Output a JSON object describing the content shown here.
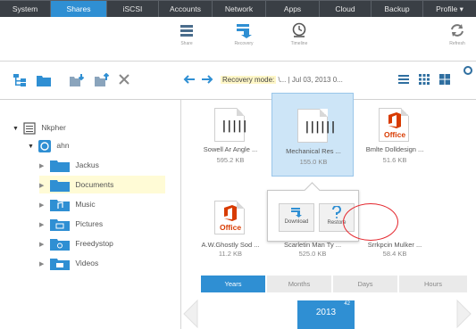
{
  "nav": {
    "tabs": [
      "System",
      "Shares",
      "iSCSI",
      "Accounts",
      "Network",
      "Apps",
      "Cloud",
      "Backup",
      "Profile ▾"
    ],
    "active_index": 1
  },
  "toolbar": {
    "share_label": "Share",
    "recovery_label": "Recovery",
    "timeline_label": "Timeline",
    "refresh_label": "Refresh"
  },
  "secbar": {
    "crumb_mode": "Recovery mode:",
    "crumb_path": " \\... | Jul 03, 2013 0..."
  },
  "tree": {
    "root": "Nkpher",
    "user": "ahn",
    "folders": [
      "Jackus",
      "Documents",
      "Music",
      "Pictures",
      "Freedystop",
      "Videos"
    ],
    "selected_folder_index": 1
  },
  "files": [
    {
      "name": "Sowell Ar Angle ...",
      "size": "595.2 KB",
      "type": "barcode"
    },
    {
      "name": "Mechanical Res ...",
      "size": "155.0 KB",
      "type": "barcode",
      "selected": true
    },
    {
      "name": "Bmlte Dolldesign ...",
      "size": "51.6 KB",
      "type": "office"
    },
    {
      "name": "A.W.Ghostly Sod ...",
      "size": "11.2 KB",
      "type": "office"
    },
    {
      "name": "Scarletin Man Ty ...",
      "size": "525.0 KB",
      "type": "hidden"
    },
    {
      "name": "Srrkpcin Mulker ...",
      "size": "58.4 KB",
      "type": "hidden"
    }
  ],
  "office_word": "Office",
  "popup": {
    "download_label": "Download",
    "restore_label": "Restore"
  },
  "timeline": {
    "tabs": [
      "Years",
      "Months",
      "Days",
      "Hours"
    ],
    "active_index": 0,
    "year": "2013",
    "year_badge": "42"
  },
  "colors": {
    "accent": "#2f8fd3",
    "nav_bg": "#3a3f45",
    "selection": "#cde5f7",
    "tree_selection": "#fffbd6",
    "office_red": "#d83b01",
    "annotation_red": "#e4242b"
  }
}
